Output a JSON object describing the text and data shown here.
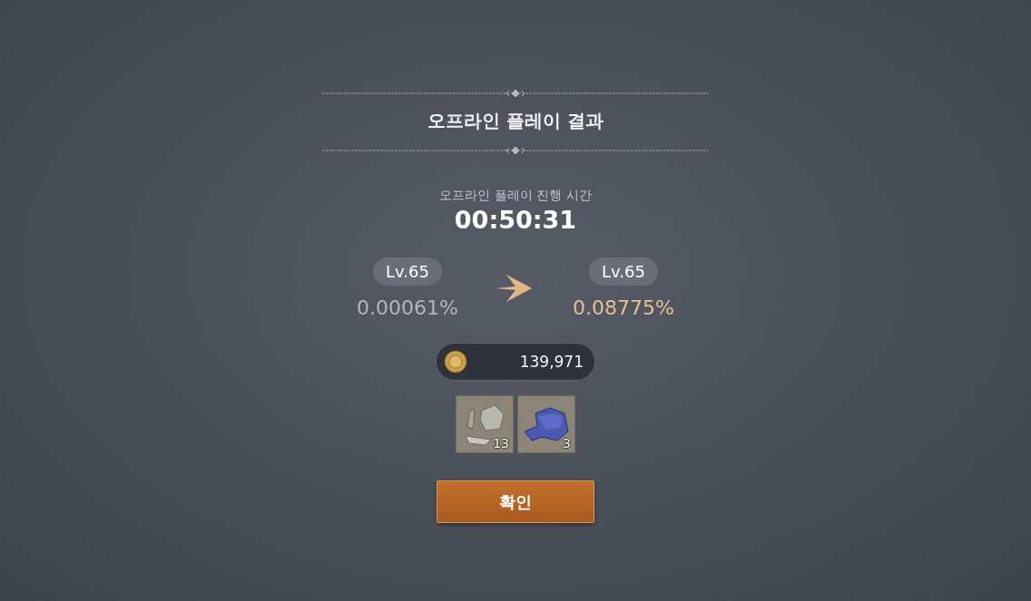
{
  "title": "오프라인 플레이 결과",
  "duration": {
    "label": "오프라인 플레이 진행 시간",
    "value": "00:50:31"
  },
  "before": {
    "level": "Lv.65",
    "exp": "0.00061%"
  },
  "after": {
    "level": "Lv.65",
    "exp": "0.08775%"
  },
  "gold": "139,971",
  "items": [
    {
      "kind": "ore",
      "count": "13"
    },
    {
      "kind": "cloth",
      "count": "3"
    }
  ],
  "confirm": "확인"
}
